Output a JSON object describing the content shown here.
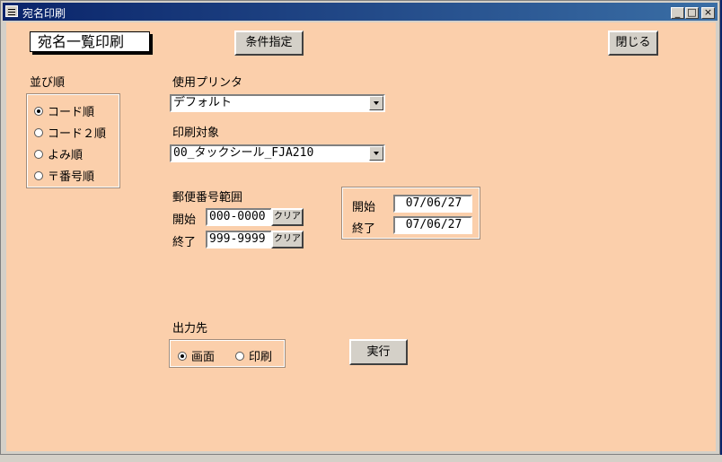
{
  "window": {
    "title": "宛名印刷"
  },
  "header": {
    "title": "宛名一覧印刷",
    "condition_button": "条件指定",
    "close_button": "閉じる"
  },
  "sort": {
    "label": "並び順",
    "options": [
      {
        "label": "コード順",
        "selected": true
      },
      {
        "label": "コード２順",
        "selected": false
      },
      {
        "label": "よみ順",
        "selected": false
      },
      {
        "label": "〒番号順",
        "selected": false
      }
    ]
  },
  "printer": {
    "label": "使用プリンタ",
    "value": "デフォルト"
  },
  "target": {
    "label": "印刷対象",
    "value": "00_タックシール_FJA210"
  },
  "postal": {
    "label": "郵便番号範囲",
    "start_label": "開始",
    "start_value": "000-0000",
    "end_label": "終了",
    "end_value": "999-9999",
    "clear_label": "クリア"
  },
  "dates": {
    "start_label": "開始",
    "start_value": "07/06/27",
    "end_label": "終了",
    "end_value": "07/06/27"
  },
  "output": {
    "label": "出力先",
    "options": [
      {
        "label": "画面",
        "selected": true
      },
      {
        "label": "印刷",
        "selected": false
      }
    ],
    "run_button": "実行"
  }
}
